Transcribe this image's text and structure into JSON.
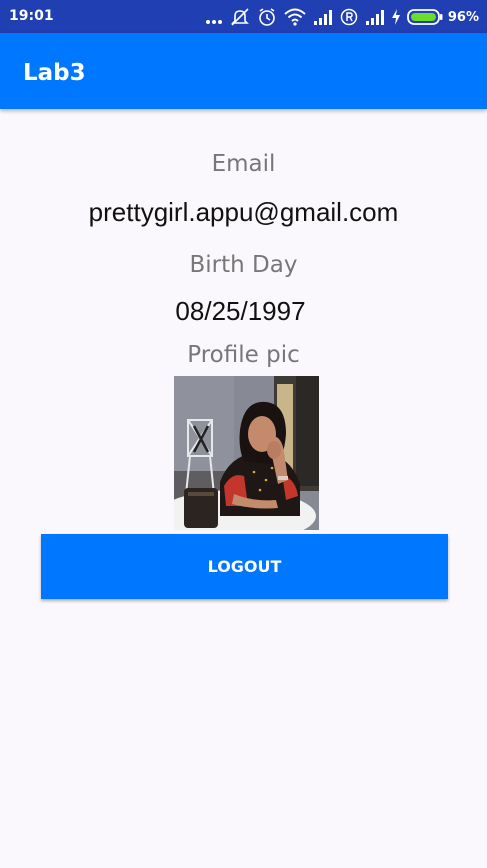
{
  "status_bar": {
    "time": "19:01",
    "battery_percent": "96%",
    "icons": [
      "more-dots-icon",
      "mute-icon",
      "alarm-icon",
      "wifi-icon",
      "signal-icon",
      "registered-icon",
      "signal-icon",
      "charging-icon",
      "battery-icon"
    ]
  },
  "app_bar": {
    "title": "Lab3"
  },
  "profile": {
    "email_label": "Email",
    "email_value": "prettygirl.appu@gmail.com",
    "birthday_label": "Birth Day",
    "birthday_value": "08/25/1997",
    "pic_label": "Profile pic"
  },
  "actions": {
    "logout_label": "LOGOUT"
  },
  "colors": {
    "status_bar": "#1F3FB3",
    "app_bar": "#0077FF",
    "button": "#0077FF",
    "background": "#FAF8FC",
    "label_text": "#777777",
    "value_text": "#111111",
    "battery_fill": "#6BDB2E"
  }
}
